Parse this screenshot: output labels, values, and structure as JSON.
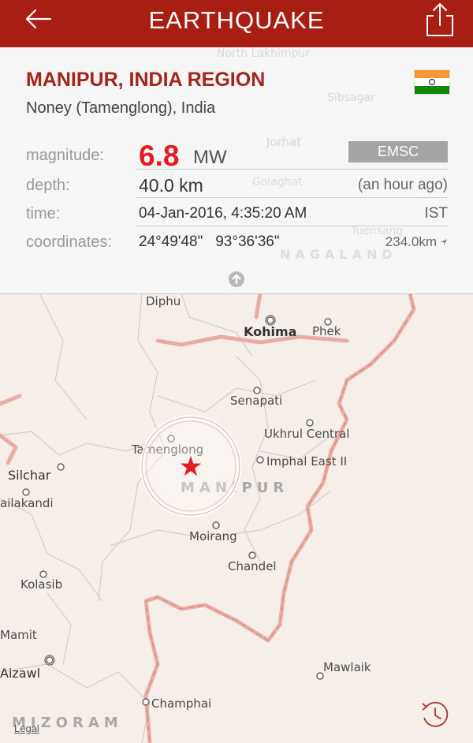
{
  "header": {
    "title": "EARTHQUAKE",
    "back_icon": "back-arrow-icon",
    "share_icon": "share-icon"
  },
  "event": {
    "region": "MANIPUR, INDIA REGION",
    "place": "Noney (Tamenglong), India",
    "flag_icon": "india-flag-icon",
    "magnitude": {
      "label": "magnitude:",
      "value": "6.8",
      "unit": "MW",
      "source": "EMSC"
    },
    "depth": {
      "label": "depth:",
      "value": "40.0 km",
      "relative": "(an hour ago)"
    },
    "time": {
      "label": "time:",
      "value": "04-Jan-2016, 4:35:20 AM",
      "zone": "IST"
    },
    "coordinates": {
      "label": "coordinates:",
      "value": "24°49'48\"   93°36'36\"",
      "distance": "234.0km"
    }
  },
  "map": {
    "places": [
      "Diphu",
      "Kohima",
      "Phek",
      "Senapati",
      "Ukhrul Central",
      "Tamenglong",
      "Imphal East II",
      "Silchar",
      "ailakandi",
      "Moirang",
      "Chandel",
      "Kolasib",
      "Mamit",
      "Aizawl",
      "Mawlaik",
      "Champhai"
    ],
    "states": [
      "MANIPUR",
      "MIZORAM",
      "NAGALAND"
    ],
    "background_places": [
      "North Lakhimpur",
      "Sibsagar",
      "Jorhat",
      "Golaghat",
      "Tuensang"
    ],
    "legal": "Legal",
    "epicenter_color": "#e31b23",
    "border_color": "#e8a29a"
  },
  "colors": {
    "accent": "#a81e12",
    "magnitude": "#e31b23",
    "badge": "#a4a4a4"
  }
}
